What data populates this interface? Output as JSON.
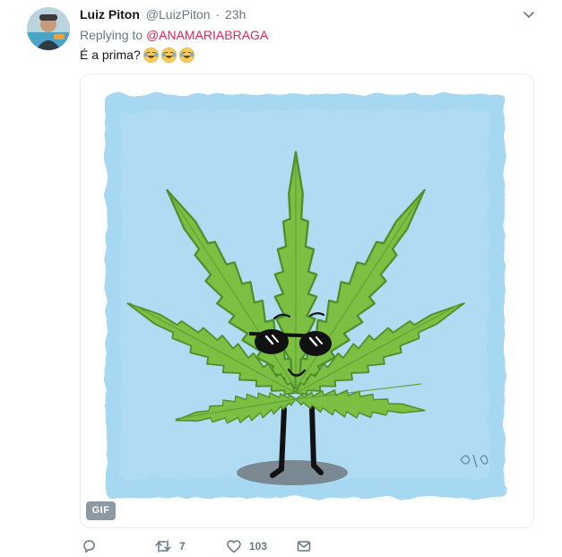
{
  "tweet": {
    "author_name": "Luiz Piton",
    "author_handle": "@LuizPiton",
    "separator": "·",
    "timestamp": "23h",
    "replying_prefix": "Replying to",
    "replying_to": "@ANAMARIABRAGA",
    "text": "É a prima?",
    "emoji_count": 3,
    "media_badge": "GIF"
  },
  "actions": {
    "retweets": "7",
    "likes": "103"
  },
  "colors": {
    "link_pink": "#e0245e",
    "secondary_gray": "#657786",
    "leaf_green": "#7bc043",
    "sky_blue": "#a7d8f2"
  },
  "icons": [
    "chevron-down-icon",
    "reply-icon",
    "retweet-icon",
    "like-icon",
    "message-icon",
    "tears-of-joy-emoji"
  ]
}
